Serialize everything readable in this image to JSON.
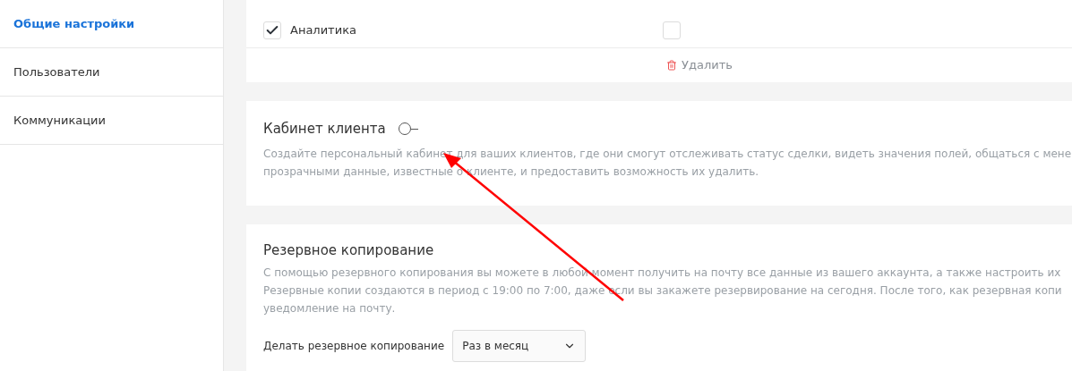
{
  "sidebar": {
    "items": [
      {
        "label": "Общие настройки",
        "selected": true
      },
      {
        "label": "Пользователи",
        "selected": false
      },
      {
        "label": "Коммуникации",
        "selected": false
      }
    ]
  },
  "permissions": {
    "rows": [
      {
        "label": "Аналитика",
        "checked": true,
        "checked_2": false
      }
    ],
    "delete_label": "Удалить"
  },
  "client_cabinet": {
    "title": "Кабинет клиента",
    "on": false,
    "description": [
      "Создайте персональный кабинет для ваших клиентов, где они смогут отслеживать статус сделки, видеть значения полей, общаться с мене",
      "прозрачными данные, известные о клиенте, и предоставить возможность их удалить."
    ]
  },
  "backup": {
    "title": "Резервное копирование",
    "description": [
      "С помощью резервного копирования вы можете в любой момент получить на почту все данные из вашего аккаунта, а также настроить их",
      "Резервные копии создаются в период с 19:00 по 7:00, даже если вы закажете резервирование на сегодня. После того, как резервная копи",
      "уведомление на почту."
    ],
    "frequency_label": "Делать резервное копирование",
    "frequency_value": "Раз в месяц"
  }
}
